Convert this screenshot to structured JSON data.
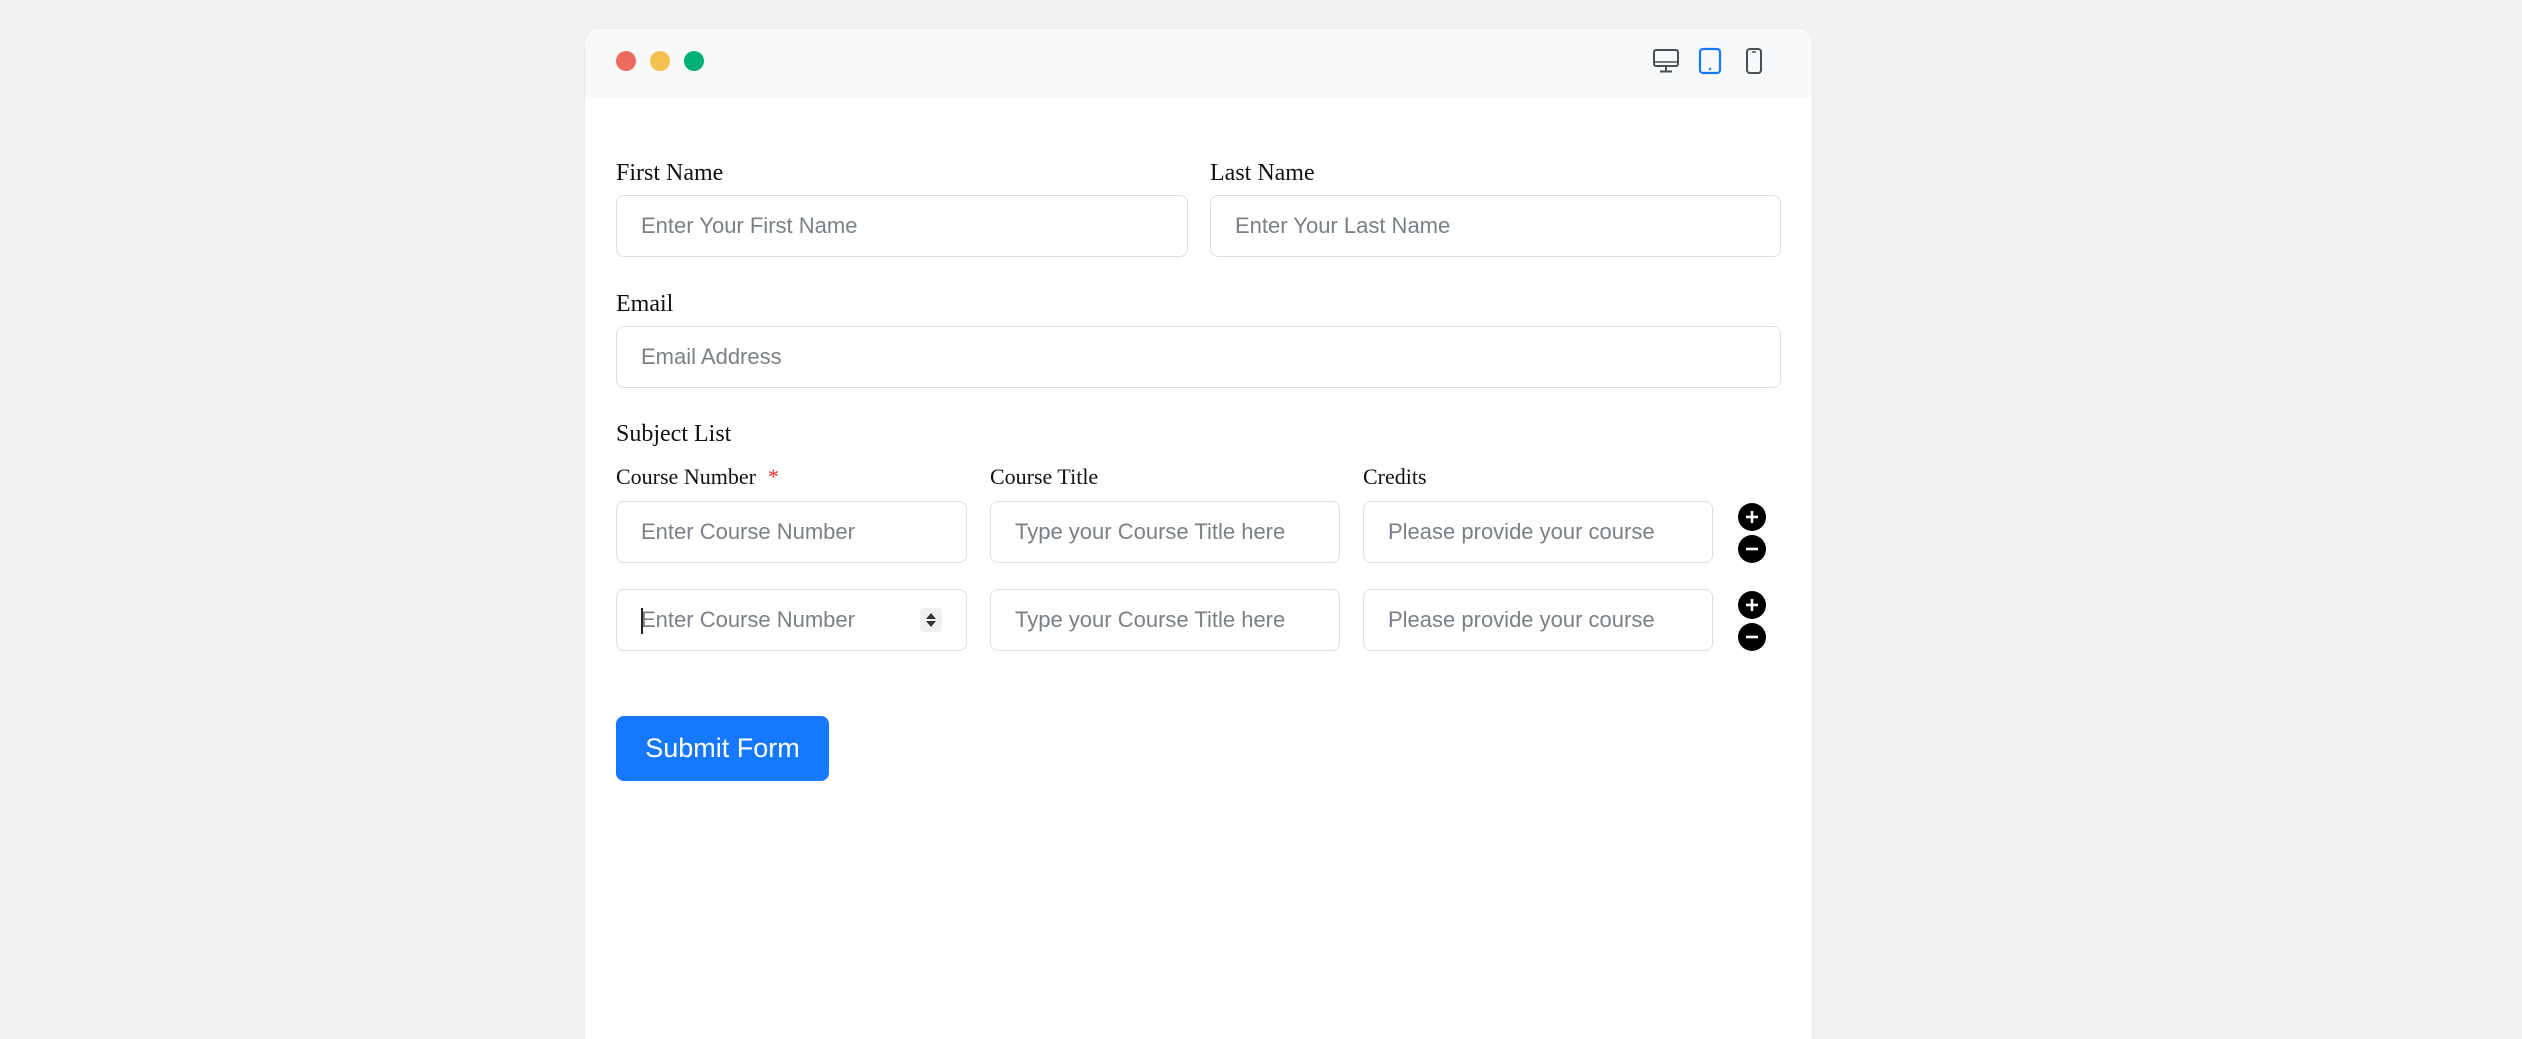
{
  "window_controls": {
    "close_color": "#ed6a5e",
    "minimize_color": "#f5bf4f",
    "maximize_color": "#00b077"
  },
  "device_toggle": {
    "items": [
      "desktop-icon",
      "tablet-icon",
      "mobile-icon"
    ],
    "active": "tablet-icon",
    "active_color": "#1677ff"
  },
  "form": {
    "first_name": {
      "label": "First Name",
      "placeholder": "Enter Your First Name"
    },
    "last_name": {
      "label": "Last Name",
      "placeholder": "Enter Your Last Name"
    },
    "email": {
      "label": "Email",
      "placeholder": "Email Address"
    },
    "subject_list": {
      "title": "Subject List",
      "columns": {
        "course_number": "Course Number",
        "required_mark": "*",
        "course_title": "Course Title",
        "credits": "Credits"
      },
      "rows": [
        {
          "course_number_placeholder": "Enter Course Number",
          "course_title_placeholder": "Type your Course Title here",
          "credits_placeholder": "Please provide your course"
        },
        {
          "course_number_placeholder": "Enter Course Number",
          "course_title_placeholder": "Type your Course Title here",
          "credits_placeholder": "Please provide your course"
        }
      ]
    },
    "submit_label": "Submit Form"
  }
}
